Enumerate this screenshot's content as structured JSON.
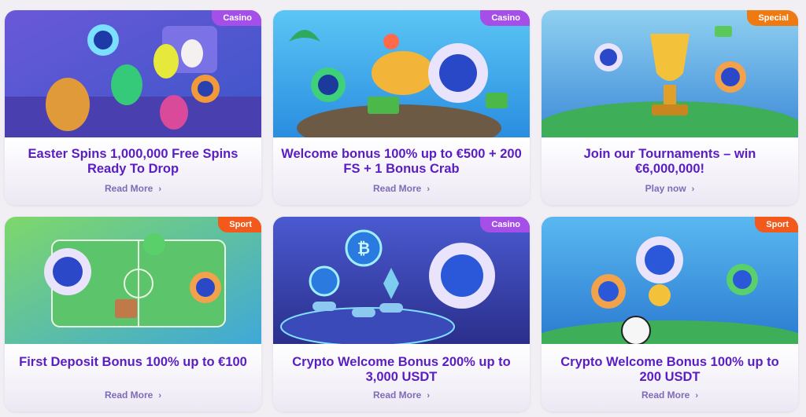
{
  "cards": [
    {
      "badge": "Casino",
      "title": "Easter Spins 1,000,000 Free Spins Ready To Drop",
      "link": "Read More"
    },
    {
      "badge": "Casino",
      "title": "Welcome bonus 100% up to €500 + 200 FS + 1 Bonus Crab",
      "link": "Read More"
    },
    {
      "badge": "Special",
      "title": "Join our Tournaments – win €6,000,000!",
      "link": "Play now"
    },
    {
      "badge": "Sport",
      "title": "First Deposit Bonus 100% up to €100",
      "link": "Read More"
    },
    {
      "badge": "Casino",
      "title": "Crypto Welcome Bonus 200% up to 3,000 USDT",
      "link": "Read More"
    },
    {
      "badge": "Sport",
      "title": "Crypto Welcome Bonus 100% up to 200 USDT",
      "link": "Read More"
    }
  ],
  "icons": {
    "chevron": "chevron-right-icon"
  },
  "colors": {
    "title": "#5a1dc2",
    "link": "#7f6bb7",
    "casino": "#a64ee8",
    "special": "#f07a12",
    "sport": "#f2591a"
  }
}
